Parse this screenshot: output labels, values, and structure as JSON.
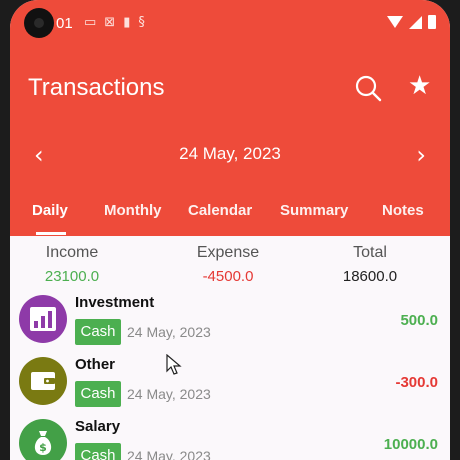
{
  "status_bar": {
    "time": "01"
  },
  "header": {
    "title": "Transactions"
  },
  "date_nav": {
    "date": "24 May, 2023"
  },
  "tabs": [
    {
      "label": "Daily"
    },
    {
      "label": "Monthly"
    },
    {
      "label": "Calendar"
    },
    {
      "label": "Summary"
    },
    {
      "label": "Notes"
    }
  ],
  "summary": {
    "income_label": "Income",
    "income_value": "23100.0",
    "expense_label": "Expense",
    "expense_value": "-4500.0",
    "total_label": "Total",
    "total_value": "18600.0"
  },
  "transactions": [
    {
      "name": "Investment",
      "account": "Cash",
      "date": "24 May, 2023",
      "amount": "500.0",
      "icon": "bar-chart-icon"
    },
    {
      "name": "Other",
      "account": "Cash",
      "date": "24 May, 2023",
      "amount": "-300.0",
      "icon": "wallet-icon"
    },
    {
      "name": "Salary",
      "account": "Cash",
      "date": "24 May, 2023",
      "amount": "10000.0",
      "icon": "money-bag-icon"
    }
  ],
  "colors": {
    "app_bar": "#ee4b3a",
    "income": "#4caf50",
    "expense": "#e53935",
    "investment_icon_bg": "#8e3aa8",
    "other_icon_bg": "#7a7a12",
    "salary_icon_bg": "#43a047"
  }
}
